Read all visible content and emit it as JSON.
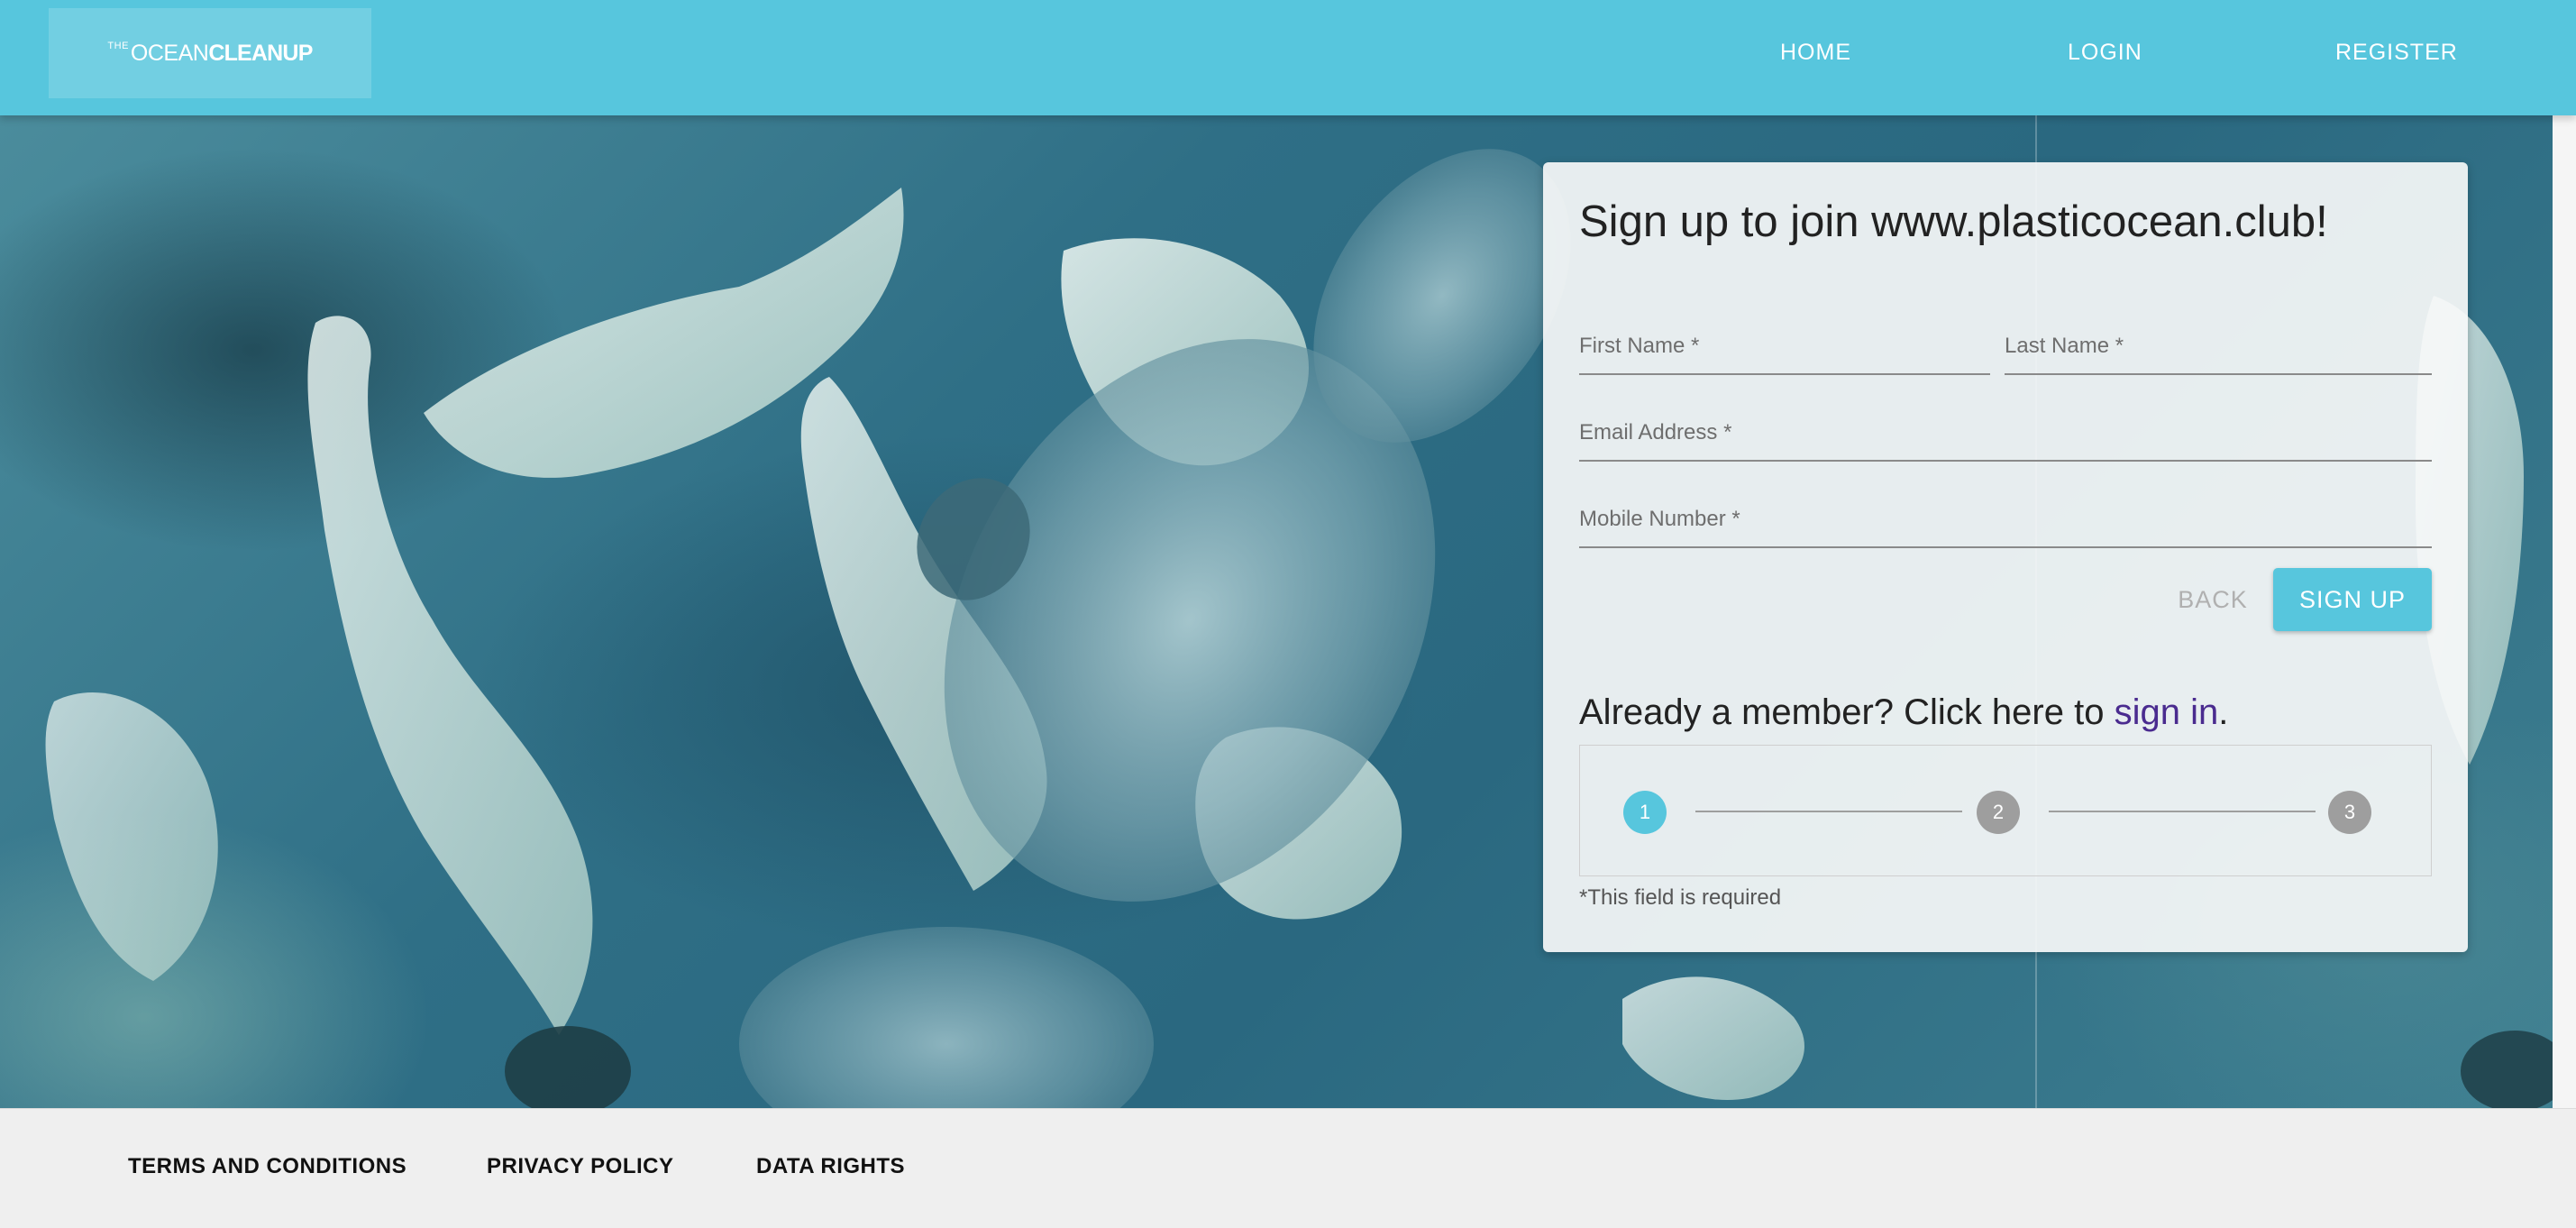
{
  "header": {
    "logo": {
      "prefix": "THE",
      "word1": "OCEAN",
      "word2": "CLEANUP"
    },
    "nav": [
      "HOME",
      "LOGIN",
      "REGISTER"
    ]
  },
  "form": {
    "title": "Sign up to join www.plasticocean.club!",
    "fields": {
      "first_name": "First Name *",
      "last_name": "Last Name *",
      "email": "Email Address *",
      "mobile": "Mobile Number *"
    },
    "back_label": "BACK",
    "signup_label": "SIGN UP",
    "member_prefix": "Already a member? Click here to ",
    "member_link": "sign in",
    "member_suffix": ".",
    "steps": [
      "1",
      "2",
      "3"
    ],
    "active_step": 1,
    "required_note": "*This field is required"
  },
  "footer": {
    "links": [
      "TERMS AND CONDITIONS",
      "PRIVACY POLICY",
      "DATA RIGHTS"
    ]
  },
  "colors": {
    "brand": "#57c6dd",
    "step_inactive": "#9e9e9e",
    "link": "#4a2b8f"
  }
}
